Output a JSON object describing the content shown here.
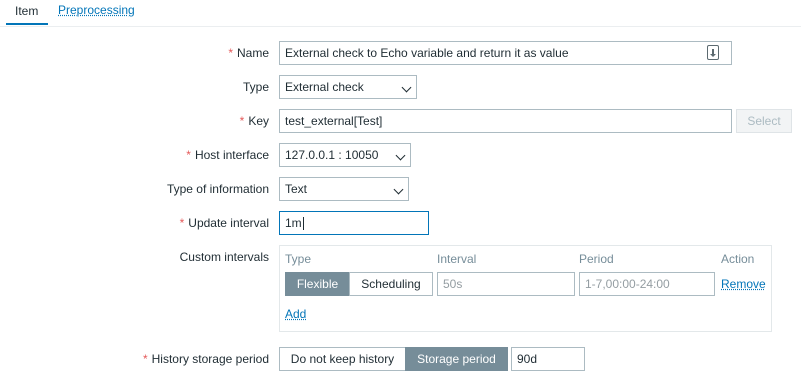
{
  "tabs": [
    {
      "label": "Item"
    },
    {
      "label": "Preprocessing"
    }
  ],
  "form": {
    "name": {
      "label": "Name",
      "required": true,
      "value": "External check to Echo variable and return it as value"
    },
    "type": {
      "label": "Type",
      "value": "External check"
    },
    "key": {
      "label": "Key",
      "required": true,
      "value": "test_external[Test]",
      "select_label": "Select"
    },
    "host_interface": {
      "label": "Host interface",
      "required": true,
      "value": "127.0.0.1 : 10050"
    },
    "type_of_information": {
      "label": "Type of information",
      "value": "Text"
    },
    "update_interval": {
      "label": "Update interval",
      "required": true,
      "value": "1m"
    },
    "custom_intervals": {
      "label": "Custom intervals",
      "headers": {
        "type": "Type",
        "interval": "Interval",
        "period": "Period",
        "action": "Action"
      },
      "row": {
        "type_options": [
          "Flexible",
          "Scheduling"
        ],
        "selected_type": "Flexible",
        "interval_placeholder": "50s",
        "period_placeholder": "1-7,00:00-24:00",
        "remove_label": "Remove"
      },
      "add_label": "Add"
    },
    "history_storage_period": {
      "label": "History storage period",
      "required": true,
      "options": [
        "Do not keep history",
        "Storage period"
      ],
      "selected": "Storage period",
      "value": "90d"
    }
  },
  "required_marker": "*",
  "colors": {
    "accent": "#0275b8",
    "required": "#e45959",
    "segment_active": "#768d99"
  }
}
